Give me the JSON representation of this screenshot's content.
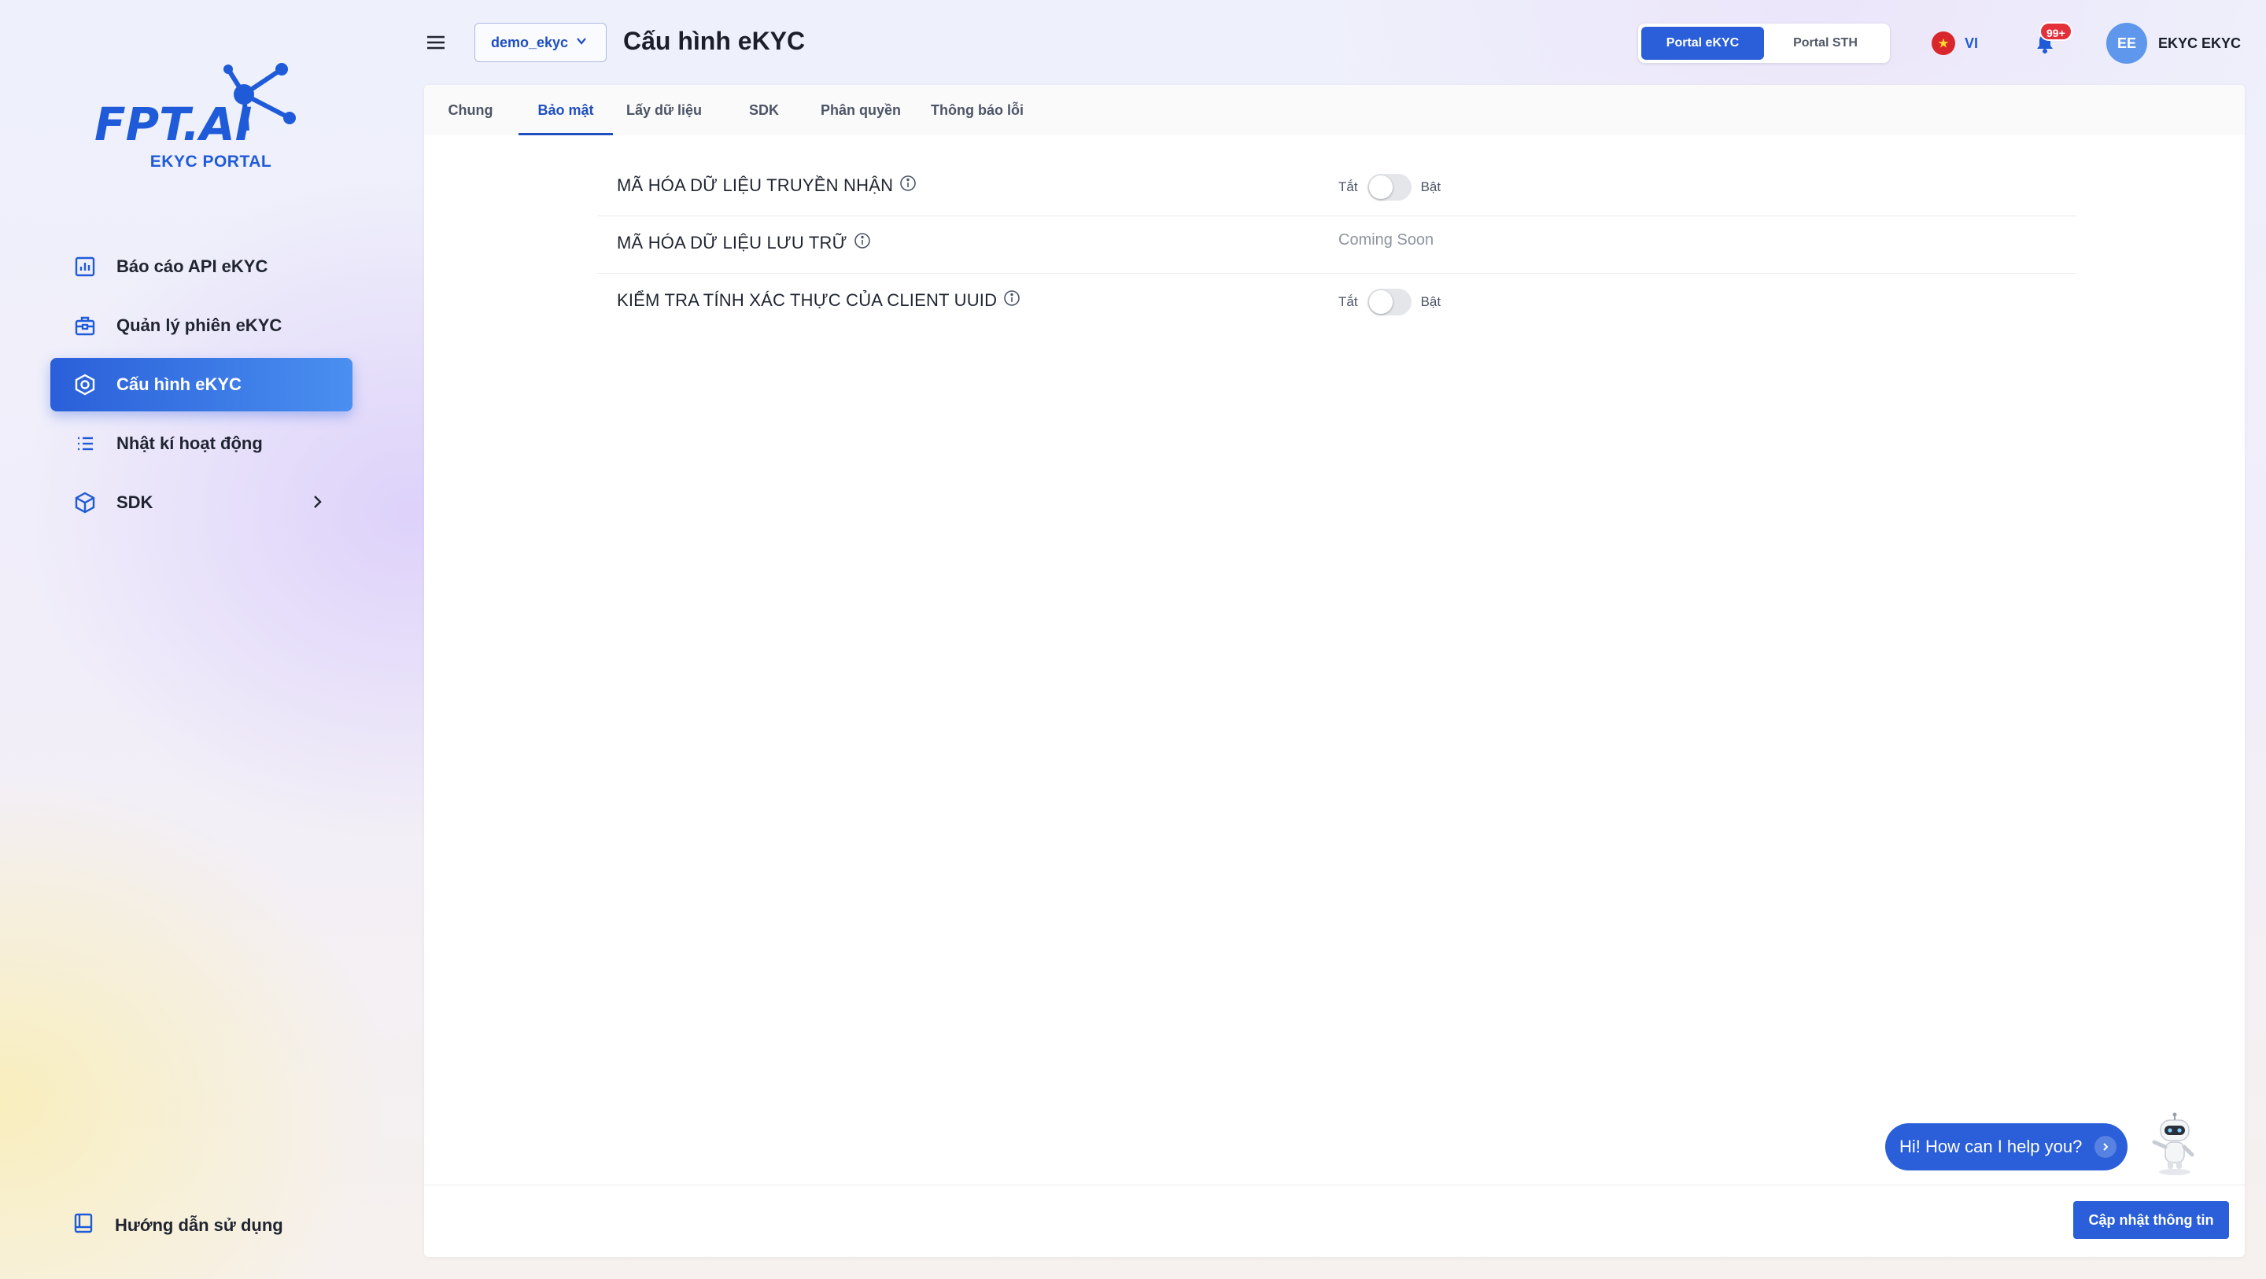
{
  "brand": {
    "logo_text": "FPT.AI",
    "portal_name": "EKYC PORTAL",
    "accent": "#2a5fd9"
  },
  "sidebar": {
    "items": [
      {
        "label": "Báo cáo API eKYC",
        "icon": "chart-icon"
      },
      {
        "label": "Quản lý phiên eKYC",
        "icon": "briefcase-icon"
      },
      {
        "label": "Cấu hình eKYC",
        "icon": "settings-hexagon-icon",
        "active": true
      },
      {
        "label": "Nhật kí hoạt động",
        "icon": "list-icon"
      },
      {
        "label": "SDK",
        "icon": "cube-icon",
        "has_children": true
      }
    ],
    "help": {
      "label": "Hướng dẫn sử dụng",
      "icon": "book-icon"
    }
  },
  "header": {
    "project": "demo_ekyc",
    "title": "Cấu hình eKYC",
    "portals": [
      "Portal eKYC",
      "Portal STH"
    ],
    "active_portal": "Portal eKYC",
    "language": "VI",
    "notifications_badge": "99+",
    "user": {
      "initials": "EE",
      "name": "EKYC EKYC"
    }
  },
  "tabs": [
    "Chung",
    "Bảo mật",
    "Lấy dữ liệu",
    "SDK",
    "Phân quyền",
    "Thông báo lỗi"
  ],
  "active_tab": "Bảo mật",
  "settings": [
    {
      "label": "MÃ HÓA DỮ LIỆU TRUYỀN NHẬN",
      "type": "toggle",
      "off_label": "Tắt",
      "on_label": "Bật",
      "enabled": false
    },
    {
      "label": "MÃ HÓA DỮ LIỆU LƯU TRỮ",
      "type": "status",
      "status": "Coming Soon"
    },
    {
      "label": "KIỂM TRA TÍNH XÁC THỰC CỦA CLIENT UUID",
      "type": "toggle",
      "off_label": "Tắt",
      "on_label": "Bật",
      "enabled": false
    }
  ],
  "footer": {
    "update_button": "Cập nhật thông tin"
  },
  "chat": {
    "prompt": "Hi! How can I help you?"
  }
}
